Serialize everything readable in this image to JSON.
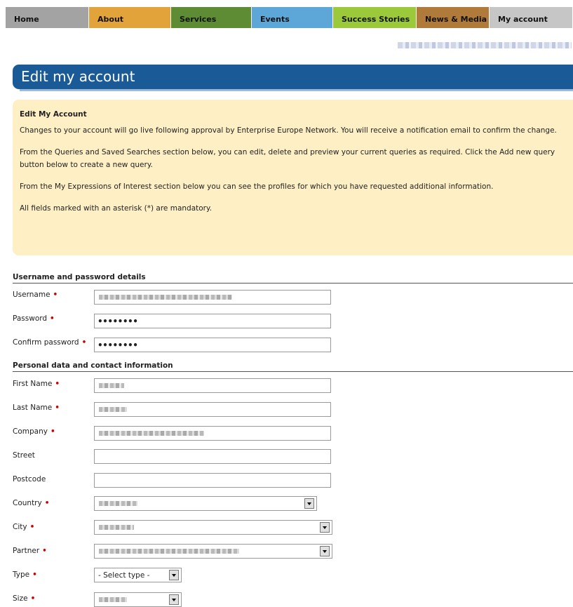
{
  "nav": [
    {
      "label": "Home",
      "color": "#a3a3a3"
    },
    {
      "label": "About",
      "color": "#e2a33b"
    },
    {
      "label": "Services",
      "color": "#5d8c34"
    },
    {
      "label": "Events",
      "color": "#5da6d8"
    },
    {
      "label": "Success Stories",
      "color": "#9bc93a"
    },
    {
      "label": "News & Media",
      "color": "#b07a3a"
    },
    {
      "label": "My account",
      "color": "#c6c6c6"
    }
  ],
  "page_title": "Edit my account",
  "info": {
    "heading": "Edit My Account",
    "p1": "Changes to your account will go live following approval by Enterprise Europe Network. You will receive a notification email to confirm the change.",
    "p2": "From the Queries and Saved Searches section below, you can edit, delete and preview your current queries as required. Click the Add new query button below to create a new query.",
    "p3": "From the My Expressions of Interest section below you can see the profiles for which you have requested additional information.",
    "p4": "All fields marked with an asterisk (*) are mandatory."
  },
  "section1": {
    "title": "Username and password details"
  },
  "section2": {
    "title": "Personal data and contact information"
  },
  "fields": {
    "username": {
      "label": "Username"
    },
    "password": {
      "label": "Password",
      "value": "••••••••"
    },
    "confirm": {
      "label": "Confirm password",
      "value": "••••••••"
    },
    "first_name": {
      "label": "First Name"
    },
    "last_name": {
      "label": "Last Name"
    },
    "company": {
      "label": "Company"
    },
    "street": {
      "label": "Street"
    },
    "postcode": {
      "label": "Postcode"
    },
    "country": {
      "label": "Country"
    },
    "city": {
      "label": "City"
    },
    "partner": {
      "label": "Partner"
    },
    "type": {
      "label": "Type",
      "value": "- Select type -"
    },
    "size": {
      "label": "Size"
    }
  },
  "required_mark": "•"
}
